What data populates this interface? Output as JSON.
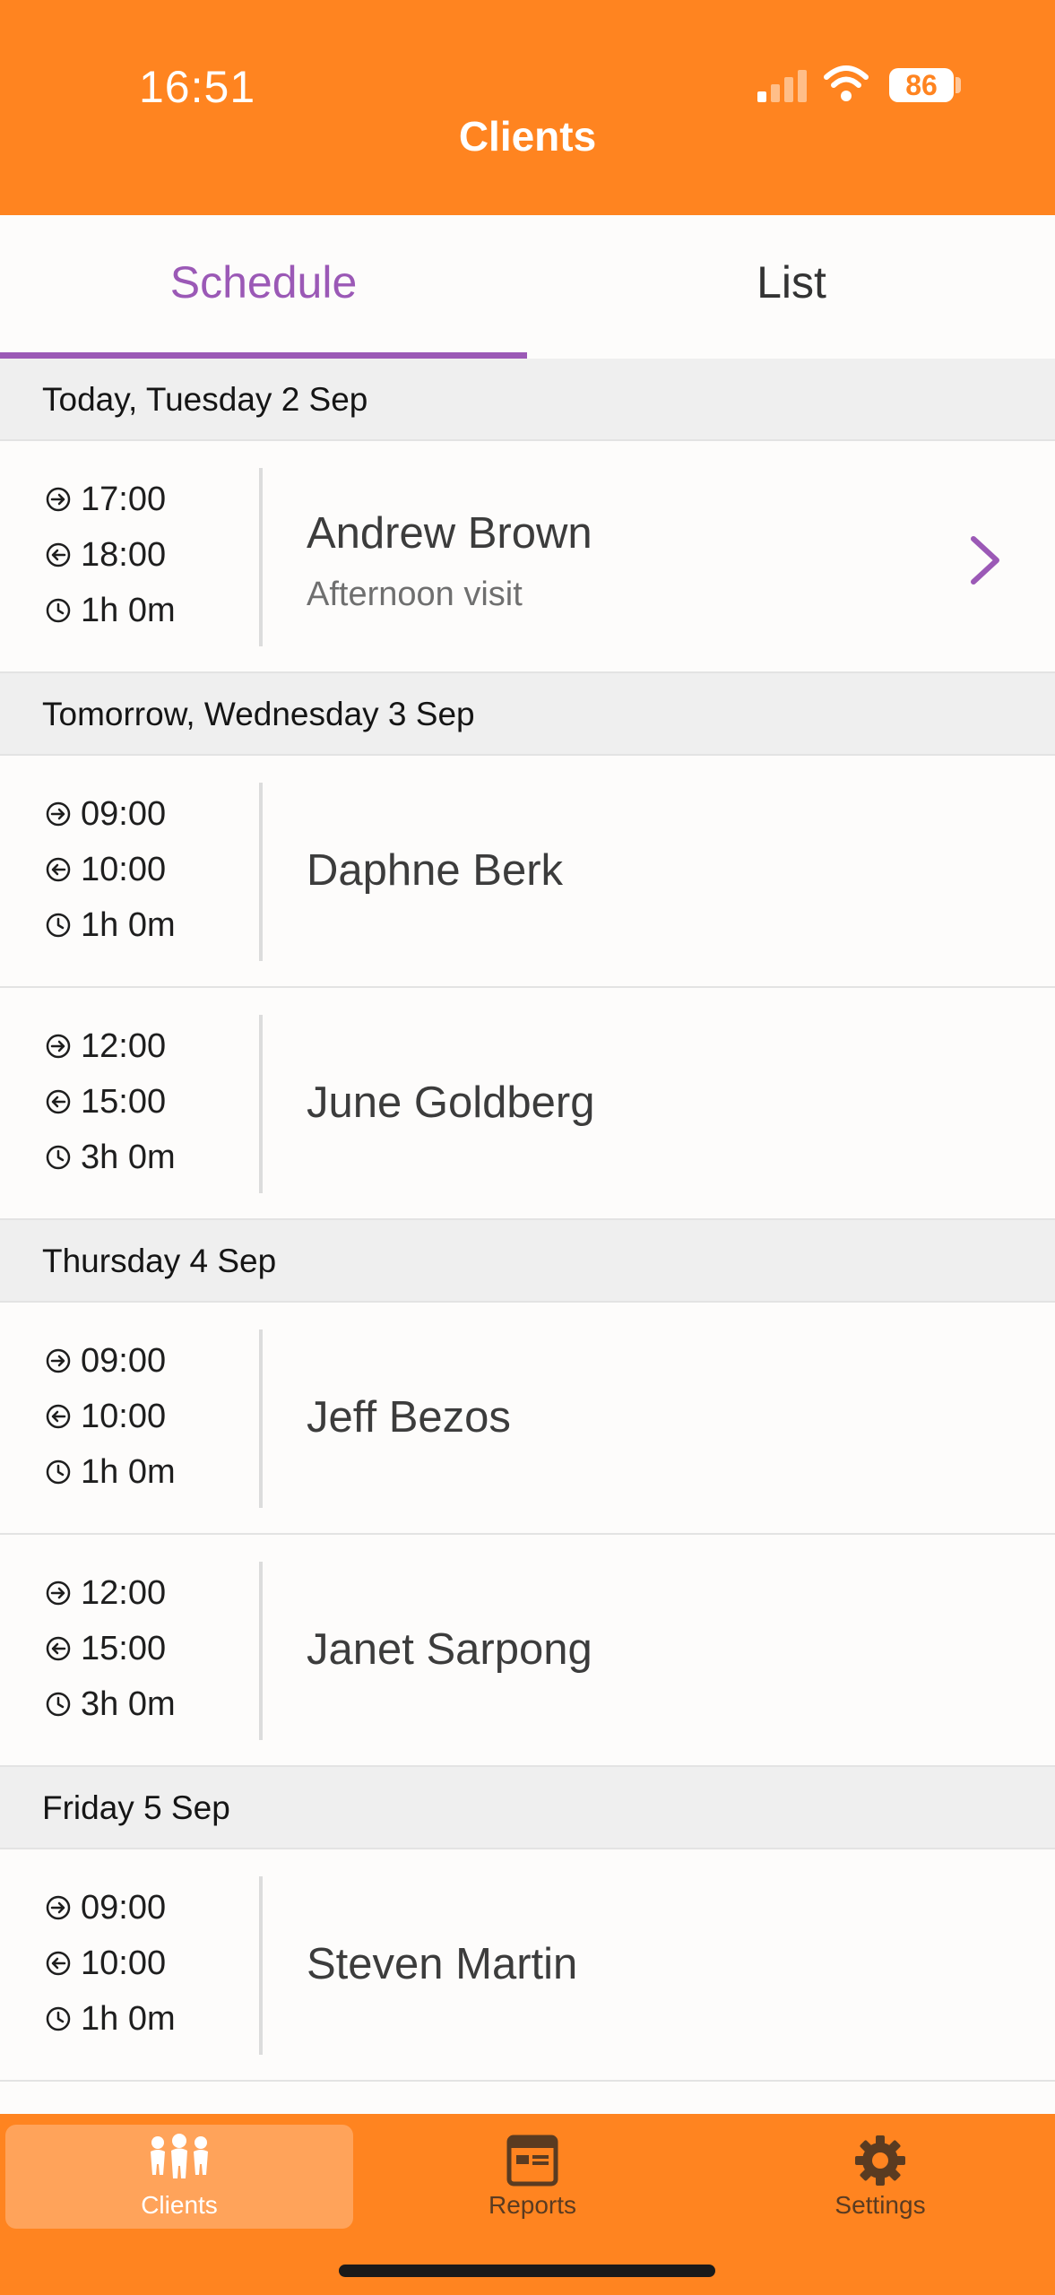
{
  "status_bar": {
    "time": "16:51",
    "battery": "86"
  },
  "header": {
    "title": "Clients"
  },
  "tabs": {
    "schedule": "Schedule",
    "list": "List"
  },
  "days": [
    {
      "label": "Today, Tuesday 2 Sep"
    },
    {
      "label": "Tomorrow, Wednesday 3 Sep"
    },
    {
      "label": "Thursday 4 Sep"
    },
    {
      "label": "Friday 5 Sep"
    }
  ],
  "visits": [
    {
      "start": "17:00",
      "end": "18:00",
      "duration": "1h 0m",
      "name": "Andrew Brown",
      "subtitle": "Afternoon visit"
    },
    {
      "start": "09:00",
      "end": "10:00",
      "duration": "1h 0m",
      "name": "Daphne Berk"
    },
    {
      "start": "12:00",
      "end": "15:00",
      "duration": "3h 0m",
      "name": "June Goldberg"
    },
    {
      "start": "09:00",
      "end": "10:00",
      "duration": "1h 0m",
      "name": "Jeff Bezos"
    },
    {
      "start": "12:00",
      "end": "15:00",
      "duration": "3h 0m",
      "name": "Janet Sarpong"
    },
    {
      "start": "09:00",
      "end": "10:00",
      "duration": "1h 0m",
      "name": "Steven Martin"
    }
  ],
  "bottom_nav": {
    "clients": "Clients",
    "reports": "Reports",
    "settings": "Settings"
  },
  "colors": {
    "brand_orange": "#ff8420",
    "accent_purple": "#9b59b6"
  }
}
